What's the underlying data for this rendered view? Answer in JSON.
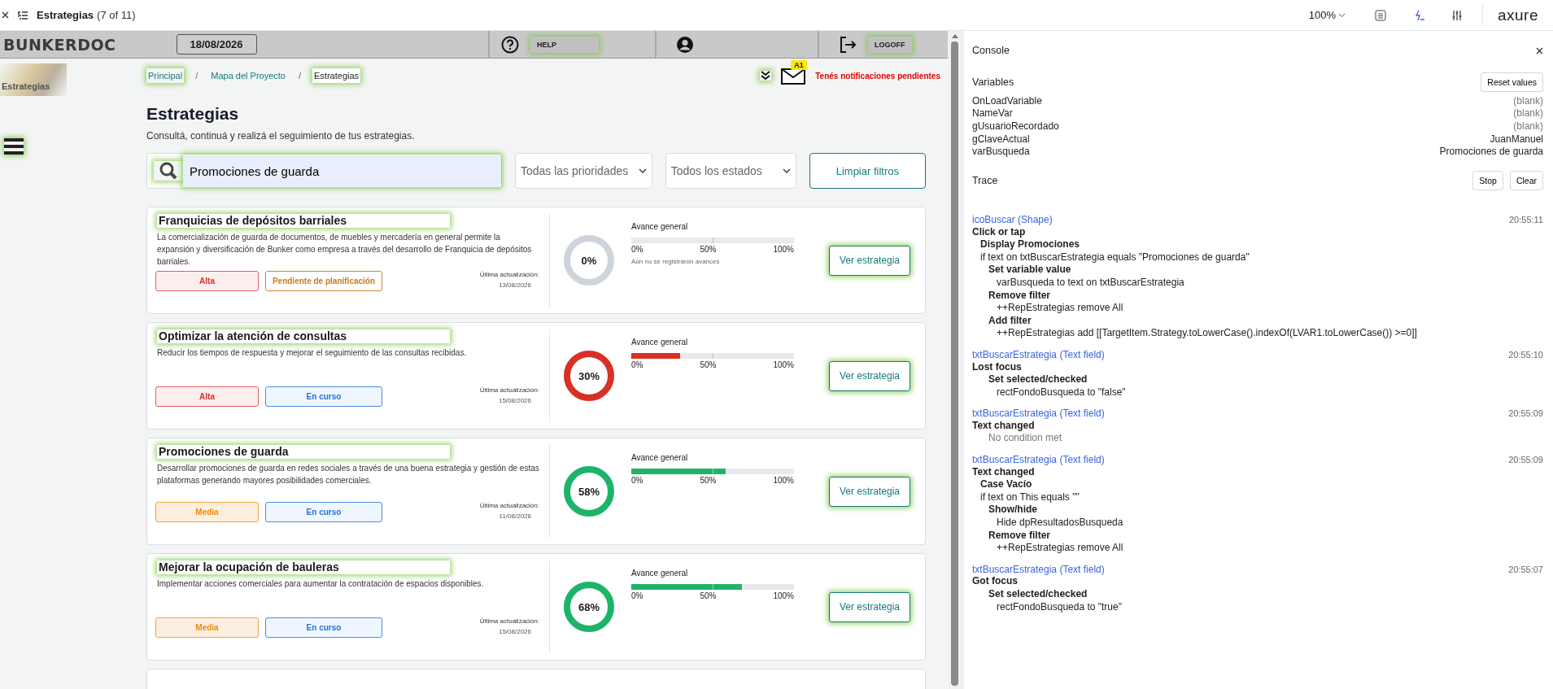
{
  "viewer": {
    "page_title": "Estrategias",
    "page_count": "(7 of 11)",
    "zoom": "100%",
    "logo": "axure"
  },
  "header": {
    "logo": "BUNKERDOC",
    "date": "18/08/2026",
    "help": "HELP",
    "logoff": "LOGOFF"
  },
  "side": {
    "thumbnail": "Estrategias"
  },
  "breadcrumb": {
    "separator": "/",
    "items": [
      {
        "label": "Principal",
        "selected": false
      },
      {
        "label": "Mapa del Proyecto",
        "selected": false
      },
      {
        "label": "Estrategias",
        "selected": true
      }
    ]
  },
  "notifications": {
    "badge": "A1",
    "message": "Tenés notificaciones pendientes"
  },
  "title": "Estrategias",
  "subtitle": "Consultá, continuá y realizá el seguimiento de tus estrategias.",
  "filters": {
    "search": "Promociones de guarda",
    "priority": "Todas las prioridades",
    "status": "Todos los estados",
    "clear": "Limpiar filtros"
  },
  "cards": [
    {
      "title": "Franquicias de depósitos barriales",
      "description": "La comercialización de guarda de documentos, de muebles y mercadería en general permite la expansión y diversificación de Bunker como empresa a través del desarrollo de Franquicia de depósitos barriales.",
      "priority": {
        "label": "Alta",
        "kind": "high"
      },
      "status": {
        "label": "Pendiente de planificación",
        "kind": "pending"
      },
      "updated_label": "Última actualización:",
      "updated_date": "13/08/2026",
      "color": "#cfd4dc",
      "progress": {
        "label": "Avance general",
        "value": "0%",
        "level": 0,
        "ticks": [
          "0%",
          "50%",
          "100%"
        ],
        "note": "Aún no se registraron avances"
      },
      "button": "Ver estrategia"
    },
    {
      "title": "Optimizar la atención de consultas",
      "description": "Reducir los tiempos de respuesta y mejorar el seguimiento de las consultas recibidas.",
      "priority": {
        "label": "Alta",
        "kind": "high"
      },
      "status": {
        "label": "En curso",
        "kind": "in_progress"
      },
      "updated_label": "Última actualización:",
      "updated_date": "15/08/2026",
      "color": "#d93025",
      "progress": {
        "label": "Avance general",
        "value": "30%",
        "level": 0.3,
        "ticks": [
          "0%",
          "50%",
          "100%"
        ]
      },
      "button": "Ver estrategia"
    },
    {
      "title": "Promociones de guarda",
      "description": "Desarrollar promociones de guarda en redes sociales a través de una buena estrategia y gestión de estas plataformas generando mayores posibilidades comerciales.",
      "priority": {
        "label": "Media",
        "kind": "medium"
      },
      "status": {
        "label": "En curso",
        "kind": "in_progress"
      },
      "updated_label": "Última actualización:",
      "updated_date": "11/08/2026",
      "color": "#1db46a",
      "progress": {
        "label": "Avance general",
        "value": "58%",
        "level": 0.58,
        "ticks": [
          "0%",
          "50%",
          "100%"
        ]
      },
      "button": "Ver estrategia"
    },
    {
      "title": "Mejorar la ocupación de bauleras",
      "description": "Implementar acciones comerciales para aumentar la contratación de espacios disponibles.",
      "priority": {
        "label": "Media",
        "kind": "medium"
      },
      "status": {
        "label": "En curso",
        "kind": "in_progress"
      },
      "updated_label": "Última actualización:",
      "updated_date": "15/08/2026",
      "color": "#1db46a",
      "progress": {
        "label": "Avance general",
        "value": "68%",
        "level": 0.68,
        "ticks": [
          "0%",
          "50%",
          "100%"
        ]
      },
      "button": "Ver estrategia"
    }
  ],
  "console": {
    "title": "Console",
    "variables_heading": "Variables",
    "reset": "Reset values",
    "variables": [
      {
        "name": "OnLoadVariable",
        "value": "(blank)",
        "kind": "blank"
      },
      {
        "name": "NameVar",
        "value": "(blank)",
        "kind": "blank"
      },
      {
        "name": "gUsuarioRecordado",
        "value": "(blank)",
        "kind": "blank"
      },
      {
        "name": "gClaveActual",
        "value": "JuanManuel",
        "kind": "set"
      },
      {
        "name": "varBusqueda",
        "value": "Promociones de guarda",
        "kind": "set"
      }
    ],
    "trace_heading": "Trace",
    "stop": "Stop",
    "clear": "Clear",
    "trace": [
      {
        "source": "icoBuscar (Shape)",
        "time": "20:55:11",
        "event": "Click or tap",
        "children": [
          {
            "kind": "case",
            "text": "Display Promociones"
          },
          {
            "kind": "condition",
            "text": "if text on txtBuscarEstrategia equals \"Promociones de guarda\"",
            "children": [
              {
                "kind": "action",
                "text": "Set variable value",
                "children": [
                  {
                    "kind": "detail",
                    "text": "varBusqueda to text on txtBuscarEstrategia"
                  }
                ]
              },
              {
                "kind": "action",
                "text": "Remove filter",
                "children": [
                  {
                    "kind": "detail",
                    "text": "++RepEstrategias remove All"
                  }
                ]
              },
              {
                "kind": "action",
                "text": "Add filter",
                "children": [
                  {
                    "kind": "detail",
                    "text": "++RepEstrategias add [[TargetItem.Strategy.toLowerCase().indexOf(LVAR1.toLowerCase()) >=0]]"
                  }
                ]
              }
            ]
          }
        ]
      },
      {
        "source": "txtBuscarEstrategia (Text field)",
        "time": "20:55:10",
        "event": "Lost focus",
        "children": [
          {
            "kind": "action",
            "text": "Set selected/checked",
            "children": [
              {
                "kind": "detail",
                "text": "rectFondoBusqueda to \"false\""
              }
            ]
          }
        ]
      },
      {
        "source": "txtBuscarEstrategia (Text field)",
        "time": "20:55:09",
        "event": "Text changed",
        "children": [
          {
            "kind": "note",
            "text": "No condition met"
          }
        ]
      },
      {
        "source": "txtBuscarEstrategia (Text field)",
        "time": "20:55:09",
        "event": "Text changed",
        "children": [
          {
            "kind": "case",
            "text": "Case Vacío"
          },
          {
            "kind": "condition",
            "text": "if text on This equals \"\"",
            "children": [
              {
                "kind": "action",
                "text": "Show/hide",
                "children": [
                  {
                    "kind": "detail",
                    "text": "Hide dpResultadosBusqueda"
                  }
                ]
              },
              {
                "kind": "action",
                "text": "Remove filter",
                "children": [
                  {
                    "kind": "detail",
                    "text": "++RepEstrategias remove All"
                  }
                ]
              }
            ]
          }
        ]
      },
      {
        "source": "txtBuscarEstrategia (Text field)",
        "time": "20:55:07",
        "event": "Got focus",
        "children": [
          {
            "kind": "action",
            "text": "Set selected/checked",
            "children": [
              {
                "kind": "detail",
                "text": "rectFondoBusqueda to \"true\""
              }
            ]
          }
        ]
      }
    ]
  }
}
